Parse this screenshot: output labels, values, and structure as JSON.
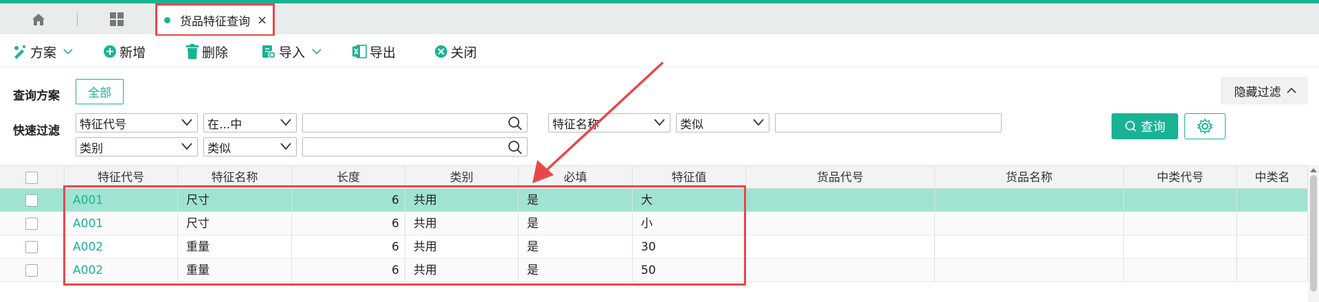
{
  "tabs": {
    "active_label": "货品特征查询",
    "close_glyph": "×"
  },
  "toolbar": {
    "scheme_label": "方案",
    "add_label": "新增",
    "delete_label": "删除",
    "import_label": "导入",
    "export_label": "导出",
    "close_label": "关闭"
  },
  "filter": {
    "query_scheme_label": "查询方案",
    "all_button": "全部",
    "hide_filter": "隐藏过滤",
    "quick_filter_label": "快速过滤",
    "field1": "特征代号",
    "op1": "在...中",
    "field2": "特征名称",
    "op2": "类似",
    "field3": "类别",
    "op3": "类似",
    "query_button": "查询"
  },
  "table": {
    "columns": [
      "特征代号",
      "特征名称",
      "长度",
      "类别",
      "必填",
      "特征值",
      "货品代号",
      "货品名称",
      "中类代号",
      "中类名"
    ],
    "rows": [
      [
        "A001",
        "尺寸",
        "6",
        "共用",
        "是",
        "大"
      ],
      [
        "A001",
        "尺寸",
        "6",
        "共用",
        "是",
        "小"
      ],
      [
        "A002",
        "重量",
        "6",
        "共用",
        "是",
        "30"
      ],
      [
        "A002",
        "重量",
        "6",
        "共用",
        "是",
        "50"
      ]
    ]
  },
  "colors": {
    "accent": "#19b394",
    "highlight": "#e8474a",
    "selected_row": "#a0e3d2"
  }
}
